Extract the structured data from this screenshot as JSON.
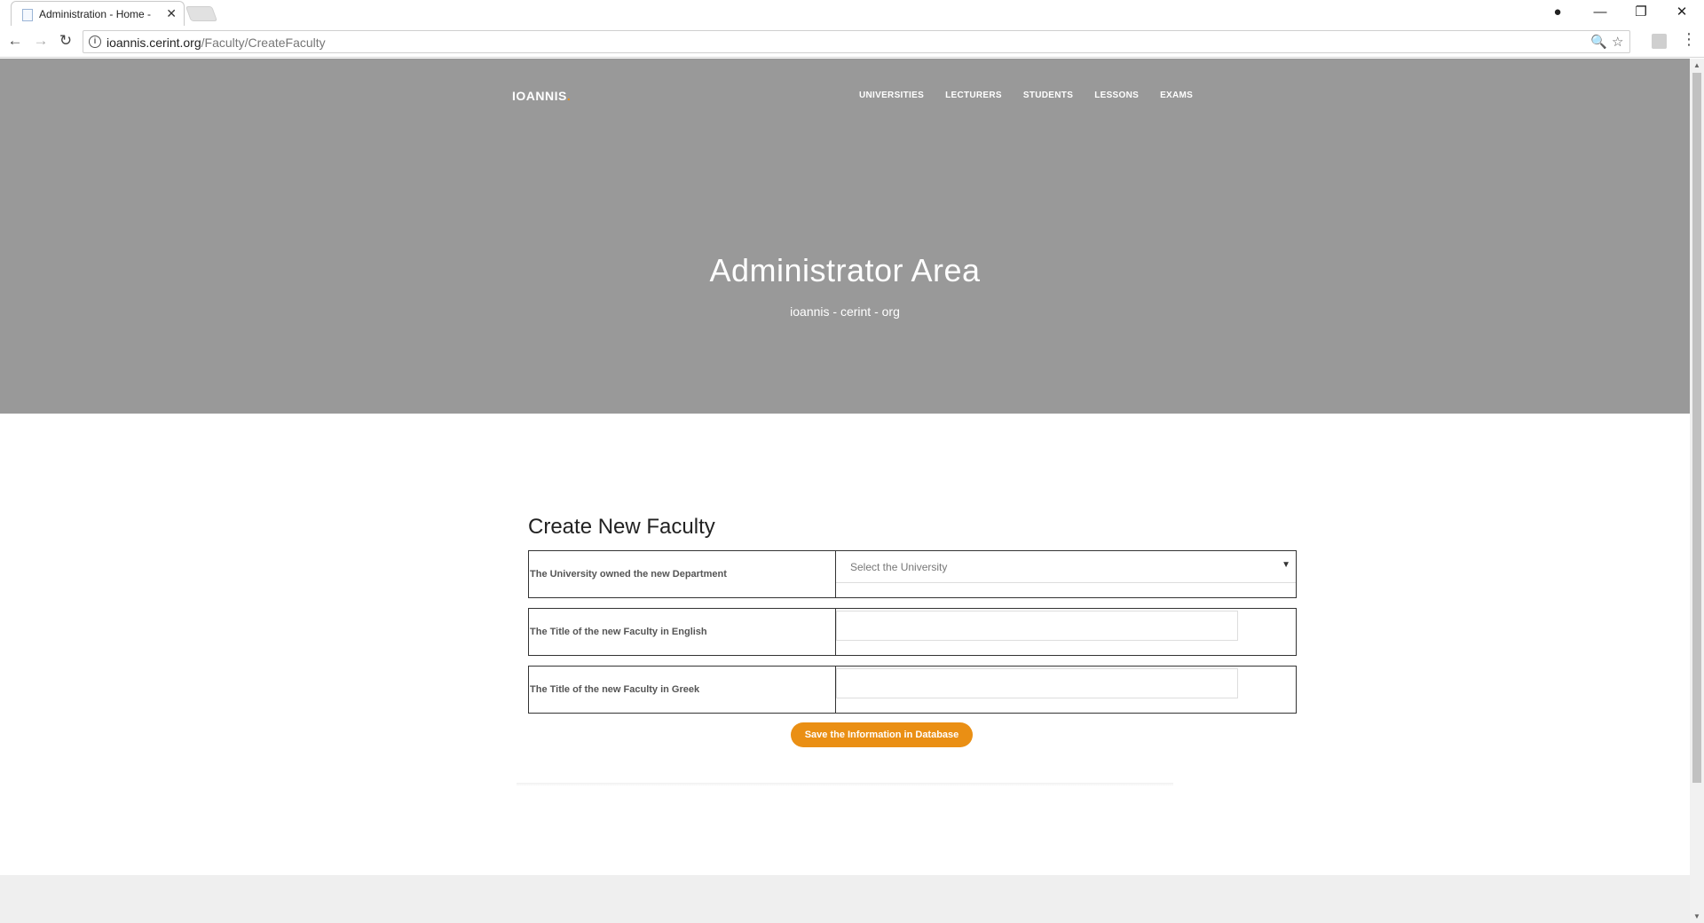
{
  "browser": {
    "tab_title": "Administration - Home - ",
    "tab_close": "✕",
    "url_host": "ioannis.cerint.org",
    "url_path": "/Faculty/CreateFaculty",
    "info_glyph": "i",
    "back_glyph": "←",
    "forward_glyph": "→",
    "reload_glyph": "↻",
    "zoom_glyph": "🔍",
    "star_glyph": "☆",
    "menu_glyph": "⋮",
    "account_glyph": "●",
    "minimize_glyph": "—",
    "restore_glyph": "❐",
    "close_glyph": "✕"
  },
  "header": {
    "brand": "IOANNIS",
    "brand_dot": ".",
    "nav": [
      "UNIVERSITIES",
      "LECTURERS",
      "STUDENTS",
      "LESSONS",
      "EXAMS"
    ]
  },
  "hero": {
    "title": "Administrator Area",
    "subtitle": "ioannis - cerint - org"
  },
  "form": {
    "title": "Create New Faculty",
    "university_label": "The University owned the new Department",
    "university_placeholder": "Select the University",
    "select_arrow": "▼",
    "english_label": "The Title of the new Faculty in English",
    "english_value": "",
    "greek_label": "The Title of the new Faculty in Greek",
    "greek_value": "",
    "save_label": "Save the Information in Database"
  },
  "scroll": {
    "up": "▲",
    "down": "▼"
  }
}
